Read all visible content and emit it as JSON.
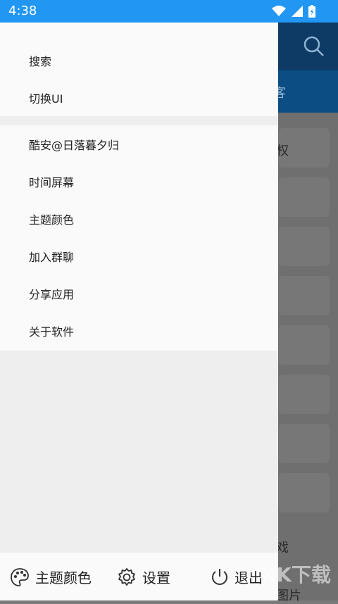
{
  "status": {
    "time": "4:38"
  },
  "drawer": {
    "section1": [
      "搜索",
      "切换UI"
    ],
    "section2": [
      "酷安@日落暮夕归",
      "时间屏幕",
      "主题颜色",
      "加入群聊",
      "分享应用",
      "关于软件"
    ],
    "bottom": {
      "theme": "主题颜色",
      "settings": "设置",
      "exit": "退出"
    }
  },
  "background": {
    "tab_label": "客",
    "card_labels": [
      "权",
      "戏",
      "图片"
    ]
  },
  "watermark": "KK下载",
  "colors": {
    "statusbar": "#2196F3",
    "drawer": "#fafafa",
    "divider": "#eeeeee"
  }
}
